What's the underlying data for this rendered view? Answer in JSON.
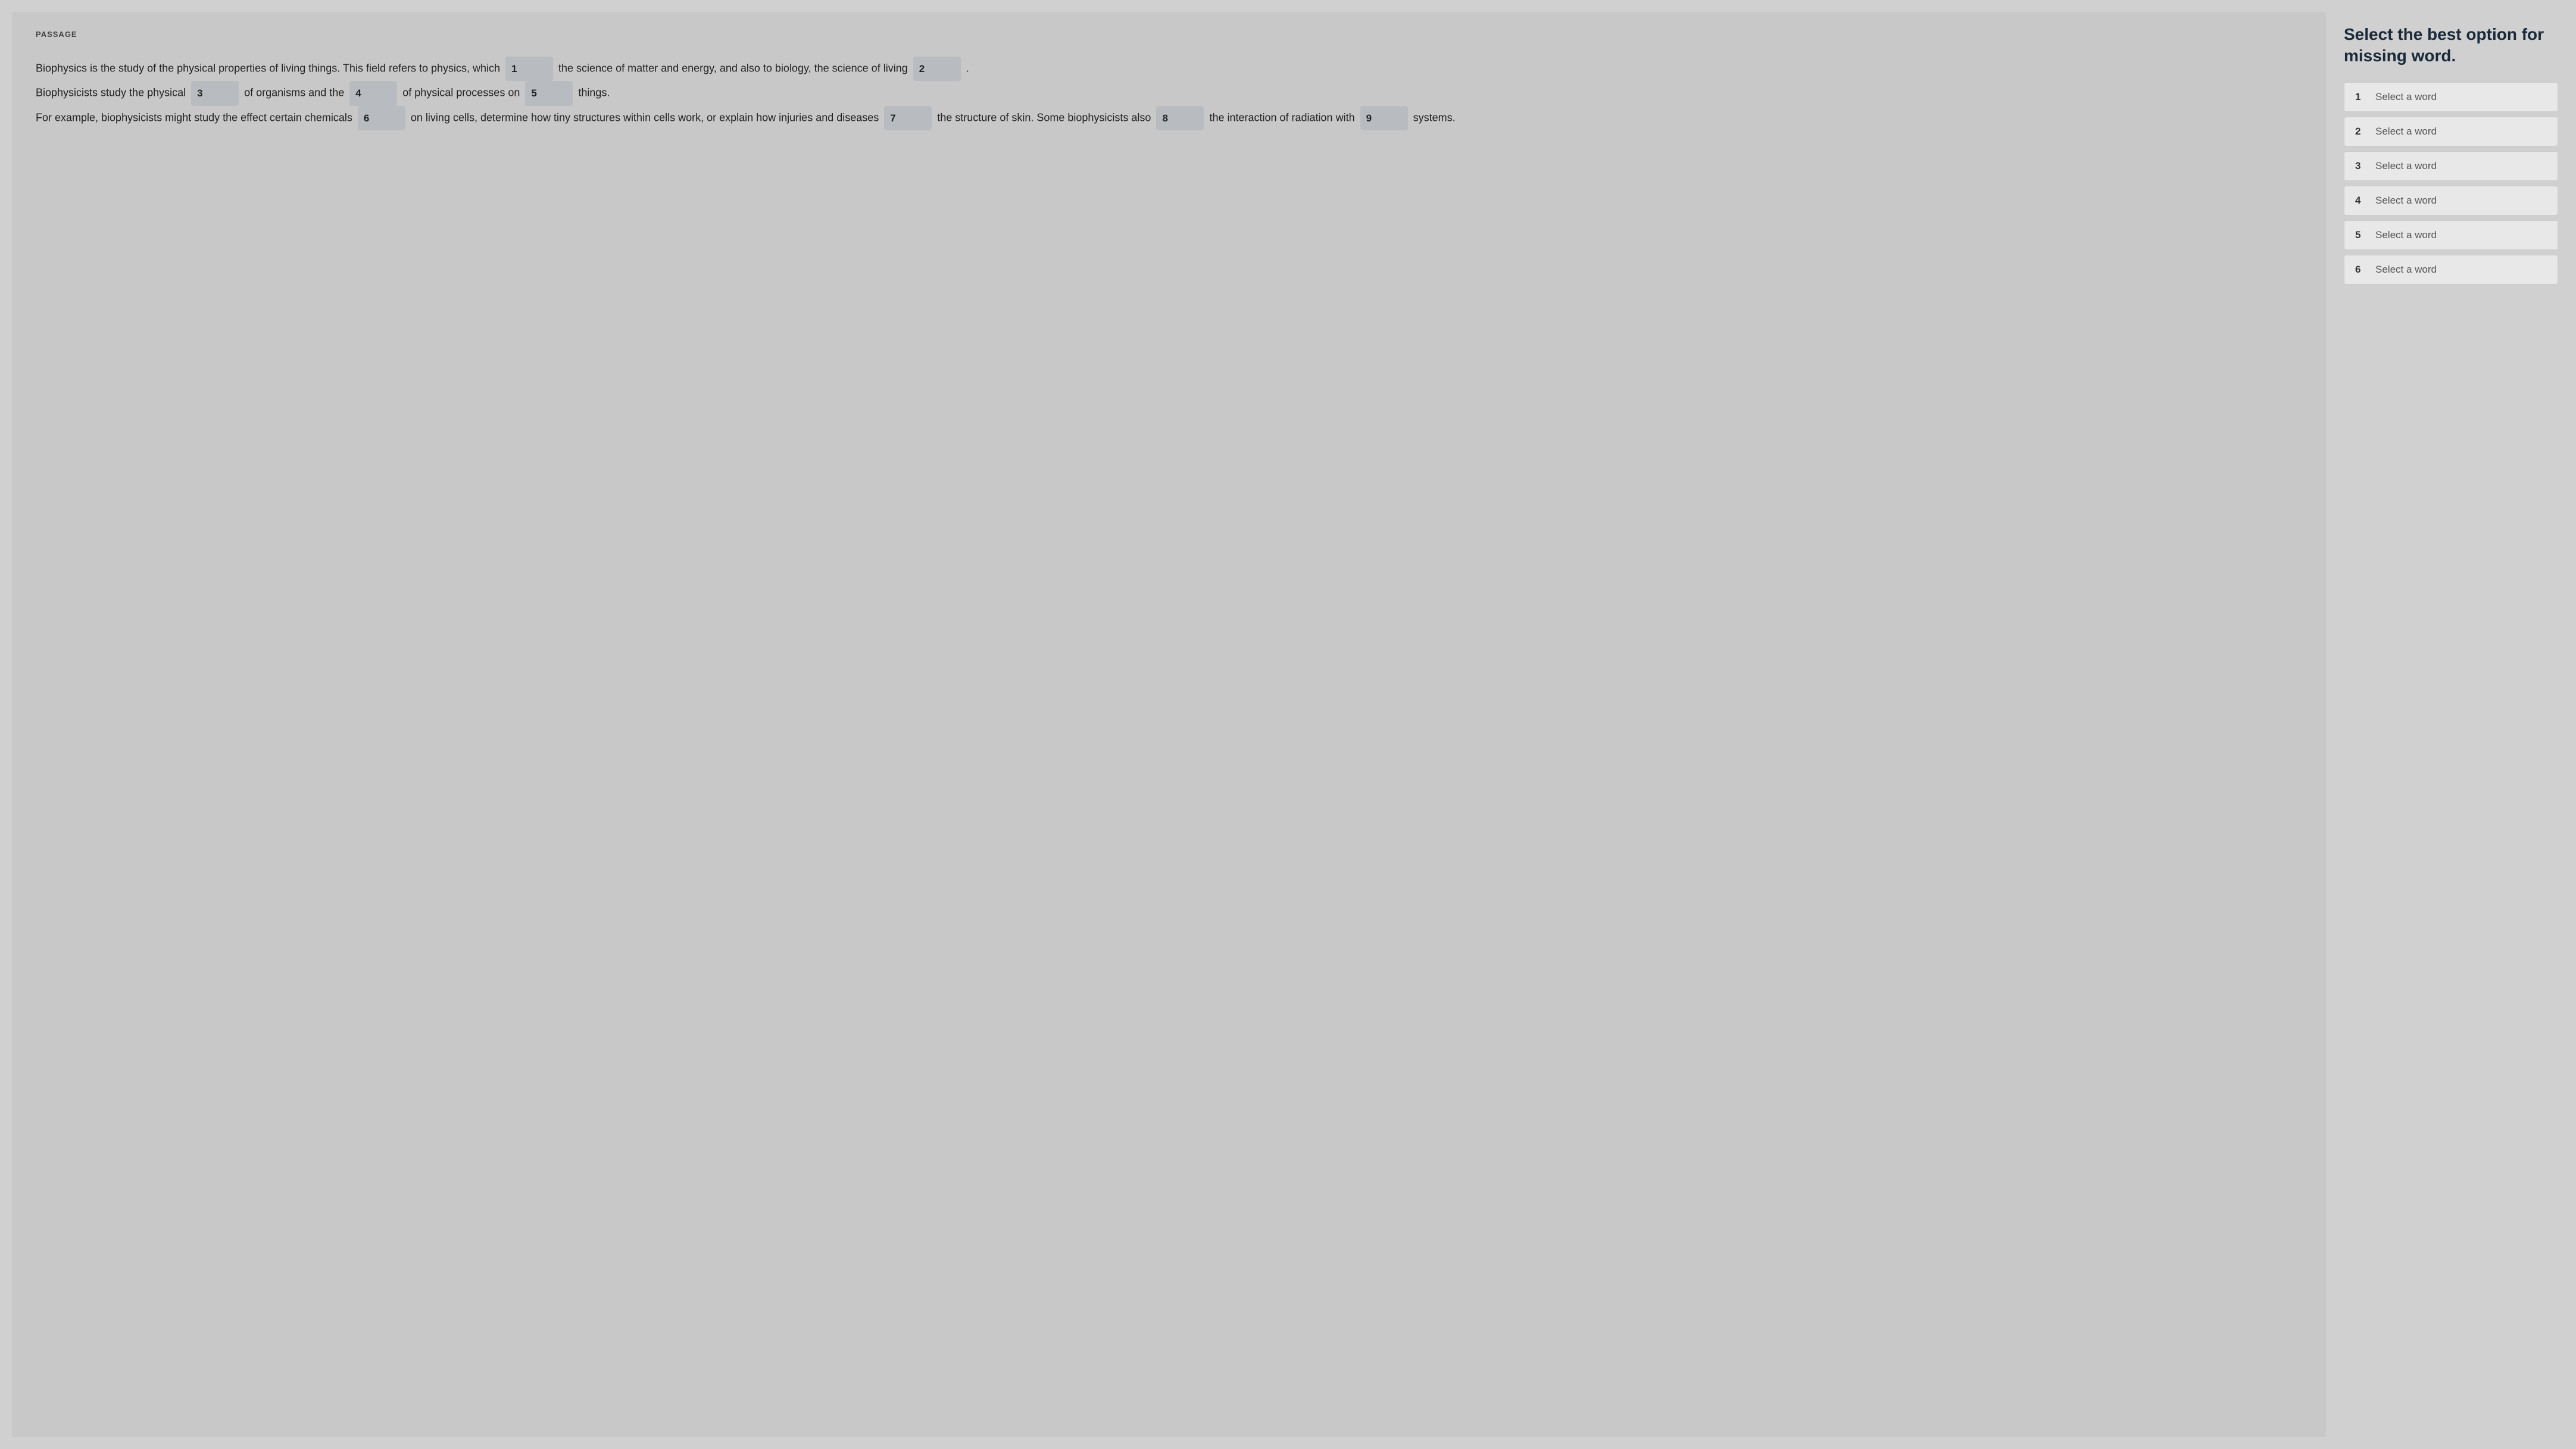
{
  "passage": {
    "label": "PASSAGE",
    "text_segments": [
      "Biophysics is the study of the physical properties of living things. This field refers to physics, which",
      "the science of matter and energy, and also to biology, the science of living",
      ". Biophysicists study the physical",
      "of organisms and the",
      "of physical processes on",
      "things. For example, biophysicists might study the effect certain chemicals",
      "on living cells, determine how tiny structures within cells work, or explain how injuries and diseases",
      "the structure of skin. Some biophysicists also",
      "the interaction of radiation with",
      "systems."
    ],
    "blanks": [
      {
        "number": "1"
      },
      {
        "number": "2"
      },
      {
        "number": "3"
      },
      {
        "number": "4"
      },
      {
        "number": "5"
      },
      {
        "number": "6"
      },
      {
        "number": "7"
      },
      {
        "number": "8"
      },
      {
        "number": "9"
      }
    ]
  },
  "right_panel": {
    "title": "Select the best option for missing word.",
    "items": [
      {
        "number": "1",
        "label": "Select a word"
      },
      {
        "number": "2",
        "label": "Select a word"
      },
      {
        "number": "3",
        "label": "Select a word"
      },
      {
        "number": "4",
        "label": "Select a word"
      },
      {
        "number": "5",
        "label": "Select a word"
      },
      {
        "number": "6",
        "label": "Select a word"
      }
    ]
  }
}
